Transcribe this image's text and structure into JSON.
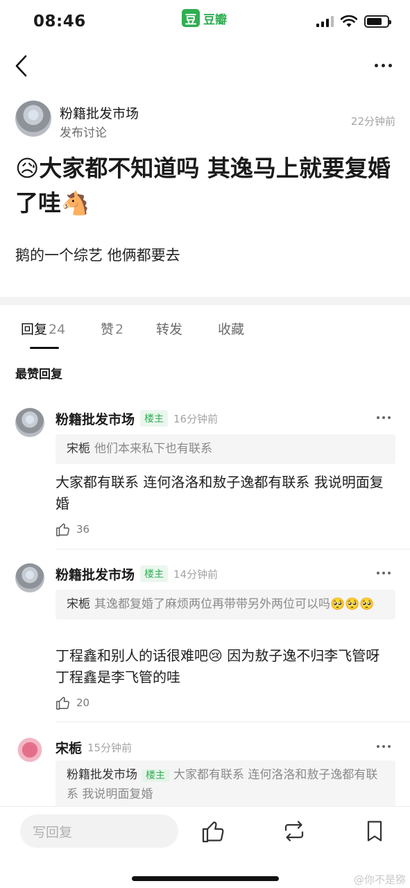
{
  "status_bar": {
    "time": "08:46",
    "app_logo_char": "豆",
    "app_name": "豆瓣",
    "battery_level": 0.75
  },
  "post": {
    "author": "粉籍批发市场",
    "action": "发布讨论",
    "time": "22分钟前",
    "title": "😥大家都不知道吗 其逸马上就要复婚了哇🐴",
    "body": "鹅的一个综艺 他俩都要去"
  },
  "tabs": [
    {
      "label": "回复",
      "count": "24"
    },
    {
      "label": "赞",
      "count": "2"
    },
    {
      "label": "转发",
      "count": ""
    },
    {
      "label": "收藏",
      "count": ""
    }
  ],
  "section_title": "最赞回复",
  "comments": [
    {
      "author": "粉籍批发市场",
      "badge": "楼主",
      "time": "16分钟前",
      "quote_author": "宋栀",
      "quote_text": "他们本来私下也有联系",
      "text": "大家都有联系 连何洛洛和敖子逸都有联系 我说明面复婚",
      "likes": "36"
    },
    {
      "author": "粉籍批发市场",
      "badge": "楼主",
      "time": "14分钟前",
      "quote_author": "宋栀",
      "quote_text": "其逸都复婚了麻烦两位再带带另外两位可以吗🥺🥺🥺",
      "text": "丁程鑫和别人的话很难吧😢 因为敖子逸不归李飞管呀 丁程鑫是李飞管的哇",
      "likes": "20"
    },
    {
      "author": "宋栀",
      "time": "15分钟前",
      "quote_author": "粉籍批发市场",
      "quote_badge": "楼主",
      "quote_text": "大家都有联系 连何洛洛和敖子逸都有联系 我说明面复婚"
    }
  ],
  "bottom_bar": {
    "reply_placeholder": "写回复"
  },
  "watermark": "@你不是猕"
}
